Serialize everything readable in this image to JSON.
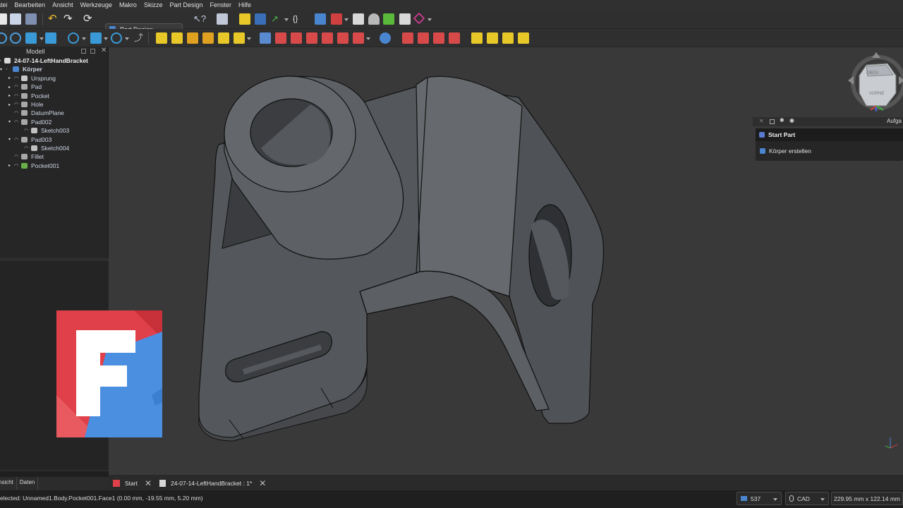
{
  "menu": [
    "atei",
    "Bearbeiten",
    "Ansicht",
    "Werkzeuge",
    "Makro",
    "Skizze",
    "Part Design",
    "Fenster",
    "Hilfe"
  ],
  "toolbar": {
    "workbench": "Part Design",
    "braces_label": "{}"
  },
  "model_panel": {
    "title": "Modell",
    "tree": [
      {
        "label": "24-07-14-LeftHandBracket",
        "level": 0,
        "bold": true,
        "arrow": "▾"
      },
      {
        "label": "Körper",
        "level": 1,
        "bold": true,
        "arrow": "▾"
      },
      {
        "label": "Ursprung",
        "level": 2,
        "arrow": "▸"
      },
      {
        "label": "Pad",
        "level": 2,
        "arrow": "▸"
      },
      {
        "label": "Pocket",
        "level": 2,
        "arrow": "▸"
      },
      {
        "label": "Hole",
        "level": 2,
        "arrow": "▸"
      },
      {
        "label": "DatumPlane",
        "level": 2,
        "arrow": ""
      },
      {
        "label": "Pad002",
        "level": 2,
        "arrow": "▾"
      },
      {
        "label": "Sketch003",
        "level": 3,
        "arrow": ""
      },
      {
        "label": "Pad003",
        "level": 2,
        "arrow": "▾"
      },
      {
        "label": "Sketch004",
        "level": 3,
        "arrow": ""
      },
      {
        "label": "Fillet",
        "level": 2,
        "arrow": ""
      },
      {
        "label": "Pocket001",
        "level": 2,
        "arrow": "▸"
      }
    ]
  },
  "left_tabs": [
    "nsicht",
    "Daten"
  ],
  "tasks": {
    "header": "Aufga",
    "title": "Start Part",
    "item": "Körper erstellen"
  },
  "navcube": {
    "top": "OBEN",
    "front": "VORNE"
  },
  "doc_tabs": [
    {
      "label": "Start"
    },
    {
      "label": "24-07-14-LeftHandBracket : 1*"
    }
  ],
  "status": {
    "text": "elected: Unnamed1.Body.Pocket001.Face1 (0.00 mm, -19.55 mm, 5.20 mm)",
    "cache": "537",
    "nav_style": "CAD",
    "dimensions": "229.95 mm x 122.14 mm"
  },
  "colors": {
    "viewport_bg": "#393939",
    "part_face": "#5f6266",
    "accent_blue": "#4a86d0",
    "logo_red": "#e0404a",
    "logo_blue": "#4a8fe0"
  }
}
